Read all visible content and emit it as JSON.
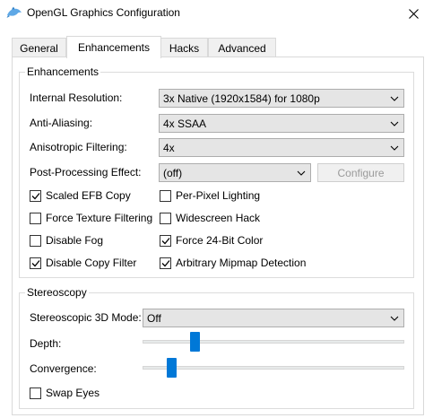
{
  "window": {
    "title": "OpenGL Graphics Configuration"
  },
  "tabs": [
    {
      "label": "General"
    },
    {
      "label": "Enhancements"
    },
    {
      "label": "Hacks"
    },
    {
      "label": "Advanced"
    }
  ],
  "enhancements": {
    "title": "Enhancements",
    "internal_resolution": {
      "label": "Internal Resolution:",
      "value": "3x Native (1920x1584) for 1080p"
    },
    "anti_aliasing": {
      "label": "Anti-Aliasing:",
      "value": "4x SSAA"
    },
    "anisotropic": {
      "label": "Anisotropic Filtering:",
      "value": "4x"
    },
    "post_processing": {
      "label": "Post-Processing Effect:",
      "value": "(off)",
      "configure_label": "Configure"
    },
    "checkboxes": [
      {
        "label": "Scaled EFB Copy",
        "checked": true
      },
      {
        "label": "Per-Pixel Lighting",
        "checked": false
      },
      {
        "label": "Force Texture Filtering",
        "checked": false
      },
      {
        "label": "Widescreen Hack",
        "checked": false
      },
      {
        "label": "Disable Fog",
        "checked": false
      },
      {
        "label": "Force 24-Bit Color",
        "checked": true
      },
      {
        "label": "Disable Copy Filter",
        "checked": true
      },
      {
        "label": "Arbitrary Mipmap Detection",
        "checked": true
      }
    ]
  },
  "stereoscopy": {
    "title": "Stereoscopy",
    "mode": {
      "label": "Stereoscopic 3D Mode:",
      "value": "Off"
    },
    "depth": {
      "label": "Depth:",
      "level": 0.2
    },
    "convergence": {
      "label": "Convergence:",
      "level": 0.11
    },
    "swap_eyes": {
      "label": "Swap Eyes",
      "checked": false
    }
  },
  "colors": {
    "accent": "#0078d7",
    "combo_bg": "#e5e5e5",
    "border": "#d9d9d9"
  },
  "icons": {
    "app": "dolphin-icon",
    "close": "close-icon",
    "dropdown": "chevron-down-icon",
    "check": "checkmark-icon"
  }
}
